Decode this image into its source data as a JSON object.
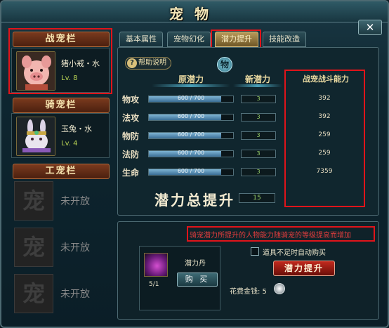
{
  "window": {
    "title": "宠物",
    "close_label": "✕"
  },
  "left": {
    "battle_header": "战宠栏",
    "battle_pet": {
      "name": "猪小戒・水",
      "level": "Lv. 8",
      "icon": "pig-pet-icon"
    },
    "mount_header": "骑宠栏",
    "mount_pet": {
      "name": "玉兔・水",
      "level": "Lv. 4",
      "icon": "rabbit-pet-icon"
    },
    "work_header": "工宠栏",
    "locked_slots": [
      {
        "glyph": "宠",
        "label": "未开放"
      },
      {
        "glyph": "宠",
        "label": "未开放"
      },
      {
        "glyph": "宠",
        "label": "未开放"
      }
    ]
  },
  "tabs": [
    {
      "label": "基本属性",
      "active": false
    },
    {
      "label": "宠物幻化",
      "active": false
    },
    {
      "label": "潜力提升",
      "active": true
    },
    {
      "label": "技能改造",
      "active": false
    }
  ],
  "potential": {
    "help_label": "帮助说明",
    "badge_glyph": "物",
    "col_original": "原潜力",
    "col_new": "新潜力",
    "col_power": "战宠战斗能力",
    "rows": [
      {
        "label": "物攻",
        "bar_text": "600 / 700",
        "fill": 0.857,
        "new": "3",
        "power": "392"
      },
      {
        "label": "法攻",
        "bar_text": "600 / 700",
        "fill": 0.857,
        "new": "3",
        "power": "392"
      },
      {
        "label": "物防",
        "bar_text": "600 / 700",
        "fill": 0.857,
        "new": "3",
        "power": "259"
      },
      {
        "label": "法防",
        "bar_text": "600 / 700",
        "fill": 0.857,
        "new": "3",
        "power": "259"
      },
      {
        "label": "生命",
        "bar_text": "600 / 700",
        "fill": 0.857,
        "new": "3",
        "power": "7359"
      }
    ],
    "total_label": "潜力总提升",
    "total_value": "15"
  },
  "bottom": {
    "notice": "骑宠潜力所提升的人物能力随骑宠的等级提高而增加",
    "item": {
      "name": "潜力丹",
      "count": "5/1",
      "icon": "potion-icon"
    },
    "buy_label": "购 买",
    "autobuy_label": "道具不足时自动购买",
    "promote_label": "潜力提升",
    "cost_label": "花费金钱: 5",
    "coin_icon": "silver-coin-icon"
  },
  "colors": {
    "highlight": "#e0141a",
    "accent_gold": "#d9c080",
    "button_red": "#c22a1e"
  }
}
